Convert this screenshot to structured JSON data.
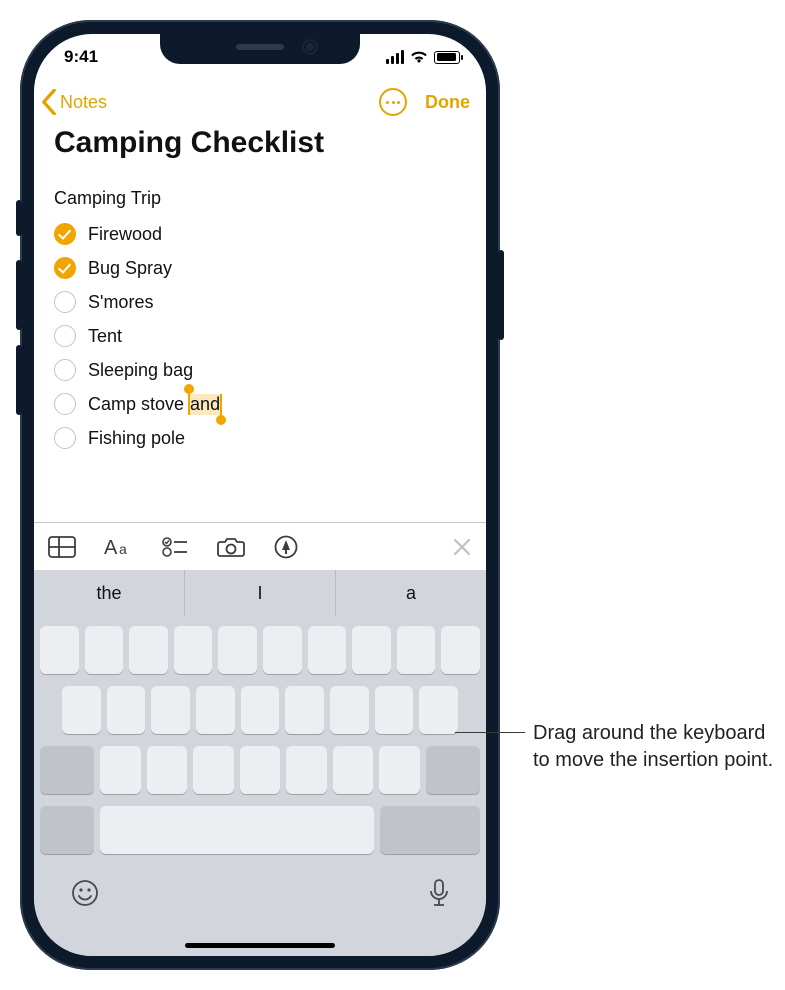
{
  "status": {
    "time": "9:41"
  },
  "nav": {
    "back_label": "Notes",
    "done_label": "Done"
  },
  "note": {
    "title": "Camping Checklist",
    "subtitle": "Camping Trip",
    "items": [
      {
        "label": "Firewood",
        "checked": true
      },
      {
        "label": "Bug Spray",
        "checked": true
      },
      {
        "label": "S'mores",
        "checked": false
      },
      {
        "label": "Tent",
        "checked": false
      },
      {
        "label": "Sleeping bag",
        "checked": false
      },
      {
        "label_pre": "Camp stove ",
        "label_sel": "and",
        "checked": false,
        "has_selection": true
      },
      {
        "label": "Fishing pole",
        "checked": false
      }
    ]
  },
  "predictive": {
    "s0": "the",
    "s1": "I",
    "s2": "a"
  },
  "callout": {
    "text": "Drag around the keyboard to move the insertion point."
  }
}
